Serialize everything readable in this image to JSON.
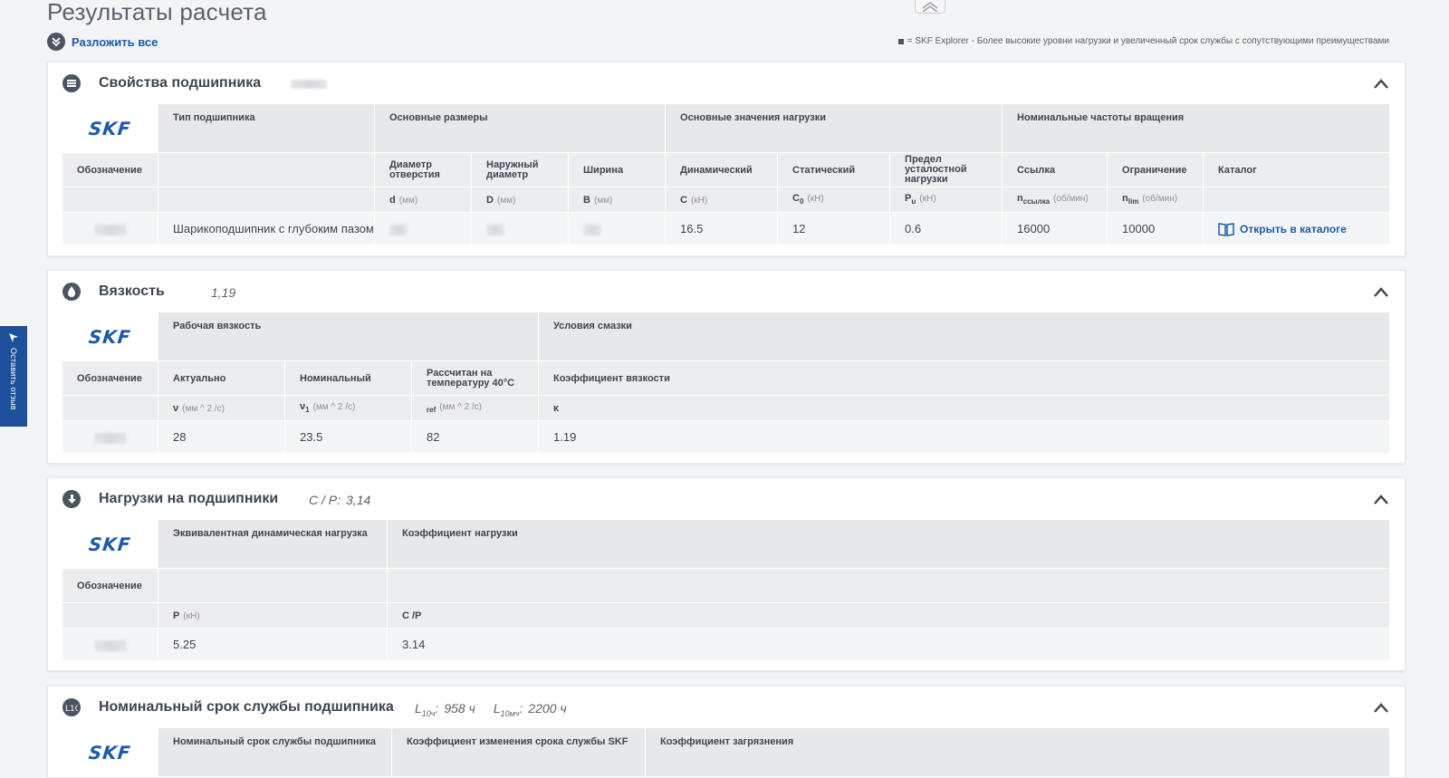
{
  "page": {
    "title": "Результаты расчета",
    "expand_all": "Разложить все",
    "legend_note": "= SKF Explorer - Более высокие уровни нагрузки и увеличенный срок службы с сопутствующими преимуществами",
    "feedback": "Оставить отзыв",
    "brand_logo": "SKF"
  },
  "bearing": {
    "title": "Свойства подшипника",
    "h": {
      "type": "Тип подшипника",
      "dims": "Основные размеры",
      "loads": "Основные значения нагрузки",
      "speeds": "Номинальные частоты вращения",
      "designation": "Обозначение",
      "bore": "Диаметр отверстия",
      "outer": "Наружный диаметр",
      "width": "Ширина",
      "dynamic": "Динамический",
      "static": "Статический",
      "fatigue": "Предел усталостной нагрузки",
      "ref": "Ссылка",
      "limit": "Ограничение",
      "catalog": "Каталог"
    },
    "u": {
      "d": "d",
      "D": "D",
      "B": "B",
      "C": "C",
      "C0": "C",
      "C0_sub": "0",
      "Pu": "P",
      "Pu_sub": "u",
      "nref": "n",
      "nref_sub": "ссылка",
      "nlim": "n",
      "nlim_sub": "lim",
      "mm": "(мм)",
      "kn": "(кН)",
      "rpm": "(об/мин)"
    },
    "row": {
      "type": "Шарикоподшипник с глубоким пазом",
      "C": "16.5",
      "C0": "12",
      "Pu": "0.6",
      "nref": "16000",
      "nlim": "10000",
      "catalog_link": "Открыть в каталоге"
    }
  },
  "viscosity": {
    "title": "Вязкость",
    "summary": "1,19",
    "h": {
      "working": "Рабочая вязкость",
      "lube": "Условия смазки",
      "designation": "Обозначение",
      "actual": "Актуально",
      "nominal": "Номинальный",
      "at40": "Рассчитан на температуру 40°C",
      "kappa_title": "Коэффициент вязкости"
    },
    "u": {
      "nu": "ν",
      "nu1": "ν",
      "nu1_sub": "1",
      "ref": "ref",
      "cst": "(мм ^ 2 /с)",
      "kappa": "κ"
    },
    "row": {
      "actual": "28",
      "nominal": "23.5",
      "at40": "82",
      "kappa": "1.19"
    }
  },
  "loads": {
    "title": "Нагрузки на подшипники",
    "summary_label": "C / P:",
    "summary_value": "3,14",
    "h": {
      "equiv": "Эквивалентная динамическая нагрузка",
      "factor": "Коэффициент нагрузки",
      "designation": "Обозначение"
    },
    "u": {
      "P": "P",
      "kn": "(кН)",
      "CP": "C /P"
    },
    "row": {
      "P": "5.25",
      "CP": "3.14"
    }
  },
  "life": {
    "title": "Номинальный срок службы подшипника",
    "s1_label": "L",
    "s1_sub": "10ч",
    "s1_value": "958 ч",
    "s2_label": "L",
    "s2_sub": "10мч",
    "s2_value": "2200 ч",
    "h": {
      "nominal": "Номинальный срок службы подшипника",
      "askf": "Коэффициент изменения срока службы SKF",
      "contam": "Коэффициент загрязнения"
    }
  }
}
